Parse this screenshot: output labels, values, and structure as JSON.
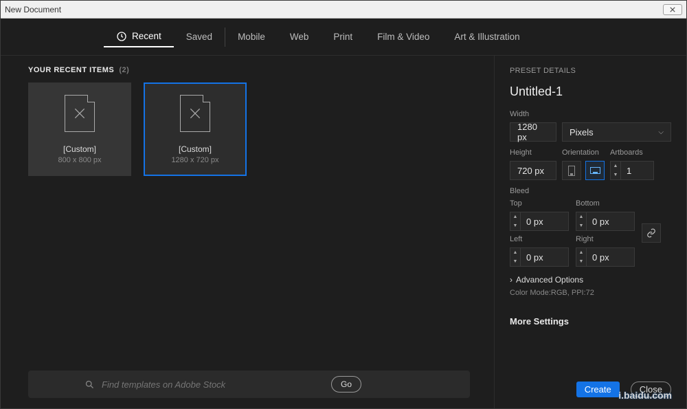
{
  "window": {
    "title": "New Document"
  },
  "tabs": {
    "recent": "Recent",
    "saved": "Saved",
    "mobile": "Mobile",
    "web": "Web",
    "print": "Print",
    "film": "Film & Video",
    "art": "Art & Illustration"
  },
  "recent": {
    "title": "YOUR RECENT ITEMS",
    "count": "(2)",
    "items": [
      {
        "label": "[Custom]",
        "dim": "800 x 800 px"
      },
      {
        "label": "[Custom]",
        "dim": "1280 x 720 px"
      }
    ]
  },
  "search": {
    "placeholder": "Find templates on Adobe Stock",
    "go": "Go"
  },
  "preset": {
    "section": "PRESET DETAILS",
    "name": "Untitled-1",
    "width_label": "Width",
    "width": "1280 px",
    "unit": "Pixels",
    "height_label": "Height",
    "height": "720 px",
    "orientation_label": "Orientation",
    "artboards_label": "Artboards",
    "artboards": "1",
    "bleed_label": "Bleed",
    "top_label": "Top",
    "top": "0 px",
    "bottom_label": "Bottom",
    "bottom": "0 px",
    "left_label": "Left",
    "left": "0 px",
    "right_label": "Right",
    "right": "0 px",
    "advanced": "Advanced Options",
    "hint": "Color Mode:RGB, PPI:72",
    "more": "More Settings"
  },
  "buttons": {
    "create": "Create",
    "close": "Close"
  },
  "bg": {
    "new": "New",
    "watermark": "i.baidu.com"
  }
}
